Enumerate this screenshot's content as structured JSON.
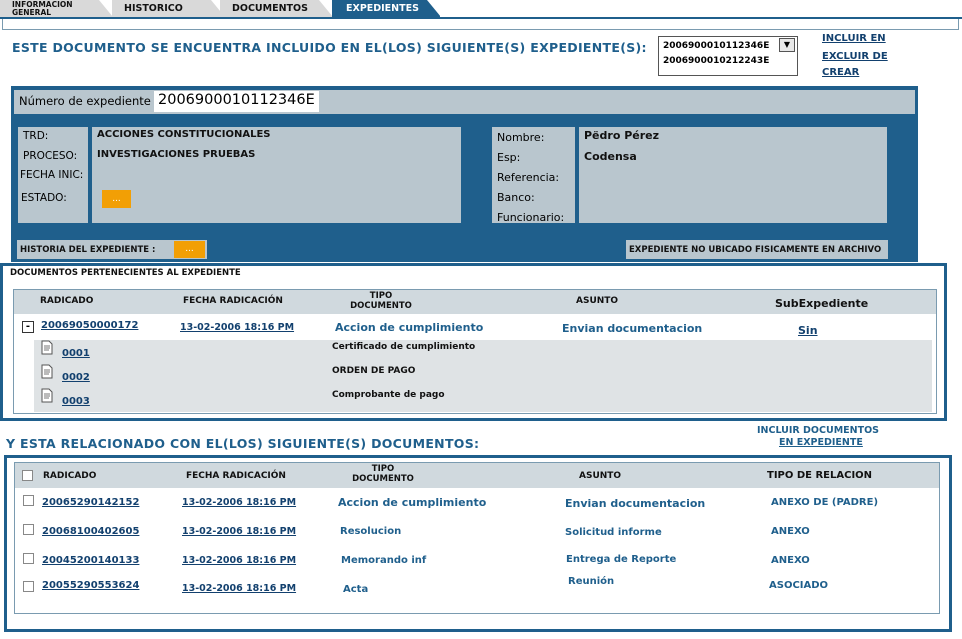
{
  "tabs": [
    {
      "label": "INFORMACION GENERAL"
    },
    {
      "label": "HISTORICO"
    },
    {
      "label": "DOCUMENTOS"
    },
    {
      "label": "EXPEDIENTES"
    }
  ],
  "included": {
    "heading": "ESTE DOCUMENTO SE ENCUENTRA INCLUIDO EN EL(LOS) SIGUIENTE(S) EXPEDIENTE(S):",
    "options": [
      "2006900010112346E",
      "2006900010212243E"
    ],
    "links": [
      "INCLUIR EN",
      "EXCLUIR DE",
      "CREAR"
    ]
  },
  "expediente": {
    "number_label": "Número de expediente",
    "number_value": "2006900010112346E",
    "left_labels": [
      "TRD:",
      "PROCESO:",
      "FECHA INIC:",
      "ESTADO:"
    ],
    "trd": "ACCIONES CONSTITUCIONALES",
    "proceso": "INVESTIGACIONES PRUEBAS",
    "estado_btn": "...",
    "right_labels": [
      "Nombre:",
      "Esp:",
      "Referencia:",
      "Banco:",
      "Funcionario:"
    ],
    "nombre": "Pëdro Pérez",
    "esp": "Codensa",
    "historia_label": "HISTORIA DEL EXPEDIENTE :",
    "historia_btn": "...",
    "no_ubicado": "EXPEDIENTE NO UBICADO FISICAMENTE EN ARCHIVO"
  },
  "docs_exp": {
    "title": "DOCUMENTOS PERTENECIENTES AL EXPEDIENTE",
    "headers": [
      "RADICADO",
      "FECHA RADICACIÓN",
      "TIPO\nDOCUMENTO",
      "ASUNTO",
      "SubExpediente"
    ],
    "main_row": {
      "radicado": "20069050000172",
      "fecha": "13-02-2006 18:16 PM",
      "tipo": "Accion de cumplimiento",
      "asunto": "Envian documentacion",
      "sub": "Sin",
      "toggle": "-"
    },
    "anexos": [
      {
        "num": "0001",
        "desc": "Certificado de cumplimiento"
      },
      {
        "num": "0002",
        "desc": "ORDEN DE PAGO"
      },
      {
        "num": "0003",
        "desc": "Comprobante de pago"
      }
    ]
  },
  "related": {
    "heading": "Y ESTA RELACIONADO CON EL(LOS) SIGUIENTE(S) DOCUMENTOS:",
    "include_link_1": "INCLUIR DOCUMENTOS",
    "include_link_2": "EN EXPEDIENTE",
    "headers": [
      "RADICADO",
      "FECHA RADICACIÓN",
      "TIPO\nDOCUMENTO",
      "ASUNTO",
      "TIPO DE RELACION"
    ],
    "rows": [
      {
        "radicado": "20065290142152",
        "fecha": "13-02-2006 18:16 PM",
        "tipo": "Accion de cumplimiento",
        "asunto": "Envian documentacion",
        "relacion": "ANEXO DE (PADRE)"
      },
      {
        "radicado": "20068100402605",
        "fecha": "13-02-2006 18:16 PM",
        "tipo": "Resolucion",
        "asunto": "Solicitud informe",
        "relacion": "ANEXO"
      },
      {
        "radicado": "20045200140133",
        "fecha": "13-02-2006 18:16 PM",
        "tipo": "Memorando inf",
        "asunto": "Entrega de Reporte",
        "relacion": "ANEXO"
      },
      {
        "radicado": "20055290553624",
        "fecha": "13-02-2006 18:16 PM",
        "tipo": "Acta",
        "asunto": "Reunión",
        "relacion": "ASOCIADO"
      }
    ]
  },
  "colors": {
    "primary": "#1f5f8c",
    "panel_gray": "#b9c6ce",
    "orange": "#f29f05"
  }
}
